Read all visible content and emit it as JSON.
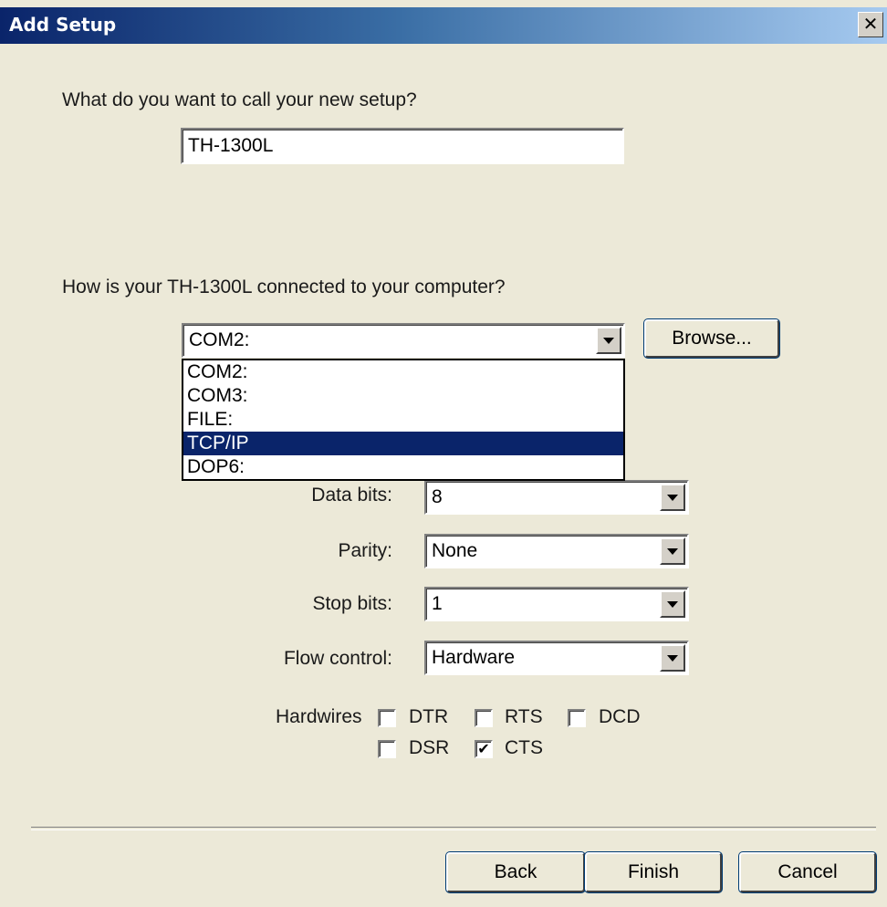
{
  "window": {
    "title": "Add Setup",
    "close_glyph": "✕"
  },
  "name_section": {
    "question": "What do you want to call your new setup?",
    "value": "TH-1300L"
  },
  "connection_section": {
    "question": "How is your TH-1300L connected to your computer?",
    "port_value": "COM2:",
    "browse_label": "Browse...",
    "port_options": [
      "COM2:",
      "COM3:",
      "FILE:",
      "TCP/IP",
      "DOP6:"
    ],
    "highlighted_option": "TCP/IP"
  },
  "serial": {
    "data_bits_label": "Data bits:",
    "data_bits_value": "8",
    "parity_label": "Parity:",
    "parity_value": "None",
    "stop_bits_label": "Stop bits:",
    "stop_bits_value": "1",
    "flow_control_label": "Flow control:",
    "flow_control_value": "Hardware",
    "hardwires_label": "Hardwires",
    "hardwires": {
      "dtr": {
        "label": "DTR",
        "checked": false
      },
      "rts": {
        "label": "RTS",
        "checked": false
      },
      "dcd": {
        "label": "DCD",
        "checked": false
      },
      "dsr": {
        "label": "DSR",
        "checked": false
      },
      "cts": {
        "label": "CTS",
        "checked": true
      }
    },
    "check_glyph": "✔"
  },
  "buttons": {
    "back": "Back",
    "finish": "Finish",
    "cancel": "Cancel"
  },
  "colors": {
    "face": "#ece9d8",
    "title_start": "#0a246a",
    "selection": "#0a246a"
  }
}
